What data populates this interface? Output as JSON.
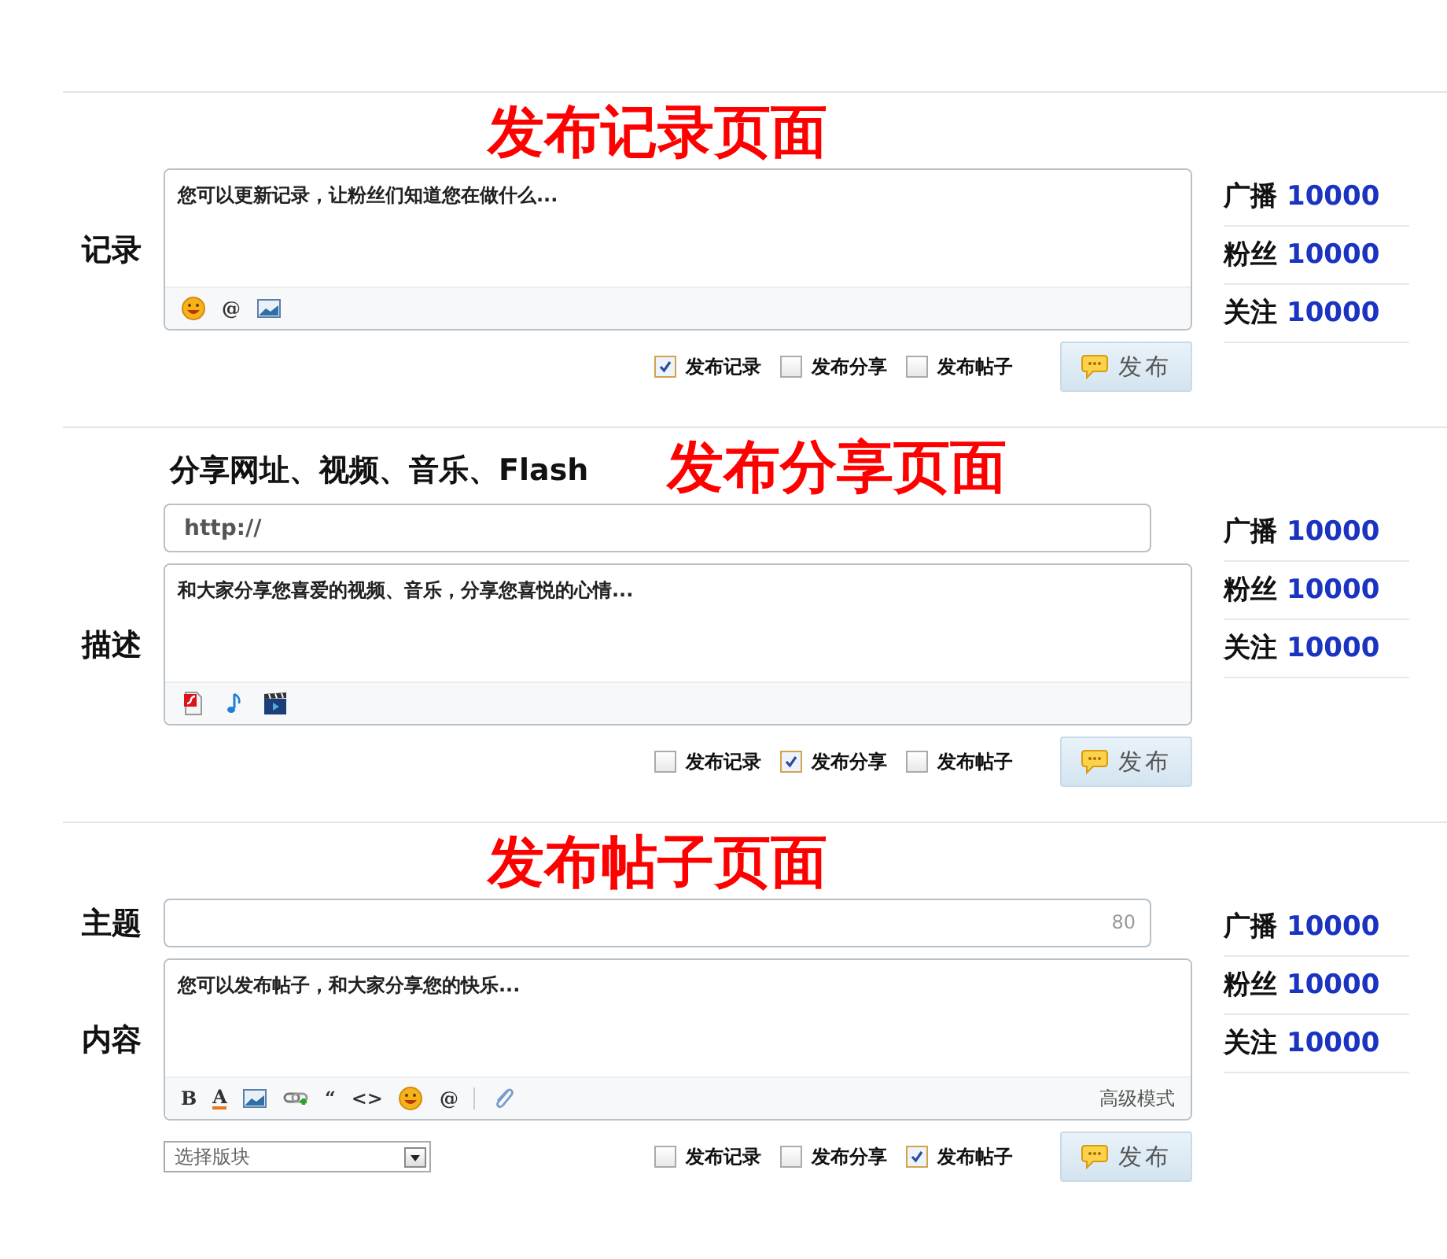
{
  "panels": [
    {
      "title": "发布记录页面",
      "rows": [
        {
          "kind": "editor",
          "label": "记录",
          "placeholder": "您可以更新记录，让粉丝们知道您在做什么...",
          "toolbar": [
            {
              "kind": "emoji"
            },
            {
              "kind": "text",
              "label": "@"
            },
            {
              "kind": "image"
            }
          ]
        }
      ],
      "options": [
        {
          "label": "发布记录",
          "checked": true
        },
        {
          "label": "发布分享",
          "checked": false
        },
        {
          "label": "发布帖子",
          "checked": false
        }
      ],
      "button": "发布",
      "stats": [
        {
          "label": "广播",
          "value": "10000"
        },
        {
          "label": "粉丝",
          "value": "10000"
        },
        {
          "label": "关注",
          "value": "10000"
        }
      ]
    },
    {
      "heading": "分享网址、视频、音乐、Flash",
      "title": "发布分享页面",
      "rows": [
        {
          "kind": "input",
          "value": "http://"
        },
        {
          "kind": "editor",
          "label": "描述",
          "placeholder": "和大家分享您喜爱的视频、音乐，分享您喜悦的心情...",
          "toolbar": [
            {
              "kind": "flash"
            },
            {
              "kind": "music"
            },
            {
              "kind": "video"
            }
          ]
        }
      ],
      "options": [
        {
          "label": "发布记录",
          "checked": false
        },
        {
          "label": "发布分享",
          "checked": true
        },
        {
          "label": "发布帖子",
          "checked": false
        }
      ],
      "button": "发布",
      "stats": [
        {
          "label": "广播",
          "value": "10000"
        },
        {
          "label": "粉丝",
          "value": "10000"
        },
        {
          "label": "关注",
          "value": "10000"
        }
      ]
    },
    {
      "title": "发布帖子页面",
      "rows": [
        {
          "kind": "input",
          "label": "主题",
          "counter": "80"
        },
        {
          "kind": "editor",
          "label": "内容",
          "placeholder": "您可以发布帖子，和大家分享您的快乐...",
          "toolbar": [
            {
              "kind": "text",
              "label": "B"
            },
            {
              "kind": "color-text",
              "label": "A"
            },
            {
              "kind": "image"
            },
            {
              "kind": "link"
            },
            {
              "kind": "text",
              "label": "“"
            },
            {
              "kind": "text",
              "label": "<>"
            },
            {
              "kind": "emoji"
            },
            {
              "kind": "text",
              "label": "@"
            },
            {
              "kind": "separator"
            },
            {
              "kind": "attach"
            }
          ],
          "mode_link": "高级模式"
        }
      ],
      "select": "选择版块",
      "options": [
        {
          "label": "发布记录",
          "checked": false
        },
        {
          "label": "发布分享",
          "checked": false
        },
        {
          "label": "发布帖子",
          "checked": true
        }
      ],
      "button": "发布",
      "stats": [
        {
          "label": "广播",
          "value": "10000"
        },
        {
          "label": "粉丝",
          "value": "10000"
        },
        {
          "label": "关注",
          "value": "10000"
        }
      ]
    }
  ]
}
